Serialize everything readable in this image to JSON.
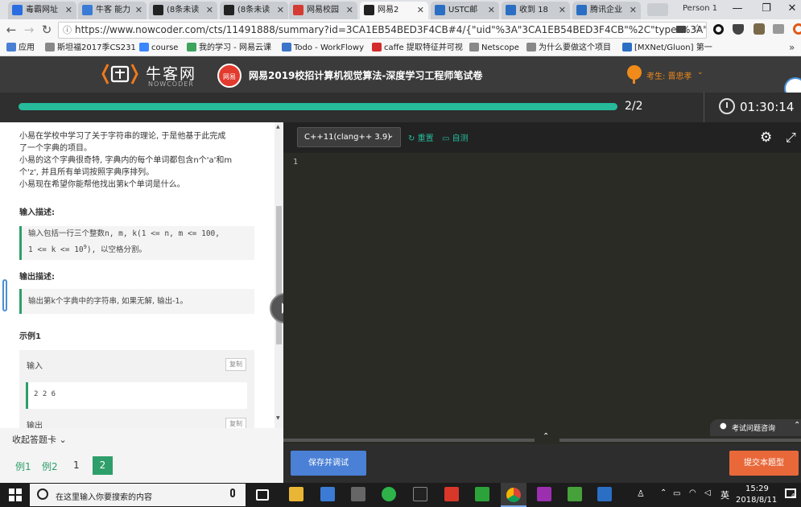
{
  "browser": {
    "tabs": [
      {
        "label": "毒霸网址",
        "icon": "k-icon",
        "color": "#2a6de0",
        "active": false
      },
      {
        "label": "牛客 能力",
        "icon": "paw-icon",
        "color": "#3a7bd5",
        "active": false
      },
      {
        "label": "(8条未读",
        "icon": "terminal-icon",
        "color": "#222222",
        "active": false
      },
      {
        "label": "(8条未读",
        "icon": "terminal-icon",
        "color": "#222222",
        "active": false
      },
      {
        "label": "网易校园",
        "icon": "netease-icon",
        "color": "#d43c33",
        "active": false
      },
      {
        "label": "网易2",
        "icon": "terminal-icon",
        "color": "#222222",
        "active": true
      },
      {
        "label": "USTC邮",
        "icon": "c-icon",
        "color": "#2b6fc4",
        "active": false
      },
      {
        "label": "收到 18",
        "icon": "mail-icon",
        "color": "#2b6fc4",
        "active": false
      },
      {
        "label": "腾讯企业",
        "icon": "mail-icon",
        "color": "#2b6fc4",
        "active": false
      }
    ],
    "profile": "Person 1",
    "window_controls": {
      "minimize": "—",
      "maximize": "❐",
      "close": "✕"
    },
    "url": "https://www.nowcoder.com/cts/11491888/summary?id=3CA1EB54BED3F4CB#4/{\"uid\"%3A\"3CA1EB54BED3F4CB\"%2C\"type\"%3A\"4\"%2C\"i...",
    "bookmarks": [
      {
        "label": "应用",
        "icon": "apps-icon",
        "color": "#4a7fd4"
      },
      {
        "label": "斯坦福2017季CS231",
        "icon": "page-icon",
        "color": "#888888"
      },
      {
        "label": "course",
        "icon": "cloud-icon",
        "color": "#3a86ff"
      },
      {
        "label": "我的学习 - 网易云课",
        "icon": "leaf-icon",
        "color": "#3da35d"
      },
      {
        "label": "Todo - WorkFlowy",
        "icon": "list-icon",
        "color": "#3b74c9"
      },
      {
        "label": "caffe 提取特征并可视",
        "icon": "c-icon",
        "color": "#d42c2c"
      },
      {
        "label": "Netscope",
        "icon": "page-icon",
        "color": "#888888"
      },
      {
        "label": "为什么要做这个项目",
        "icon": "page-icon",
        "color": "#888888"
      },
      {
        "label": "[MXNet/Gluon] 第一",
        "icon": "tv-icon",
        "color": "#2b6fc4"
      }
    ],
    "bookmarks_more": "»"
  },
  "site": {
    "logo_text": "牛客网",
    "logo_sub": "NOWCODER",
    "exam_badge": "网易",
    "exam_title": "网易2019校招计算机视觉算法-深度学习工程师笔试卷",
    "user": "考生: 晋忠孝",
    "progress_label": "2/2",
    "progress_fraction": 1.0,
    "timer": "01:30:14",
    "accent": "#25bb9b"
  },
  "problem": {
    "description": [
      "小易在学校中学习了关于字符串的理论, 于是他基于此完成",
      "了一个字典的项目。",
      "小易的这个字典很奇特, 字典内的每个单词都包含n个'a'和m",
      "个'z', 并且所有单词按照字典序排列。",
      "小易现在希望你能帮他找出第k个单词是什么。"
    ],
    "input_heading": "输入描述:",
    "input_desc_line1": "输入包括一行三个整数n, m, k(1 <= n, m <= 100,",
    "input_desc_line2_a": "1 <= k <= 10",
    "input_desc_sup": "9",
    "input_desc_line2_b": "), 以空格分割。",
    "output_heading": "输出描述:",
    "output_desc": "输出第k个字典中的字符串, 如果无解, 输出-1。",
    "example_heading": "示例1",
    "example_input_label": "输入",
    "copy_label": "复制",
    "example_input_value": "2 2 6",
    "example_output_label": "输出"
  },
  "answer_card": {
    "toggle_label": "收起答题卡 ⌄",
    "items": [
      "例1",
      "例2",
      "1",
      "2"
    ],
    "selected": "2"
  },
  "editor": {
    "language": "C++11(clang++ 3.9)",
    "reset_label": "重置",
    "selftest_label": "自测",
    "line_numbers": [
      "1"
    ],
    "save_button": "保存并调试",
    "submit_button": "提交本题型",
    "help_label": "考试问题咨询"
  },
  "taskbar": {
    "search_placeholder": "在这里输入你要搜索的内容",
    "ime": "英",
    "time": "15:29",
    "date": "2018/8/11",
    "notification_count": "4"
  }
}
